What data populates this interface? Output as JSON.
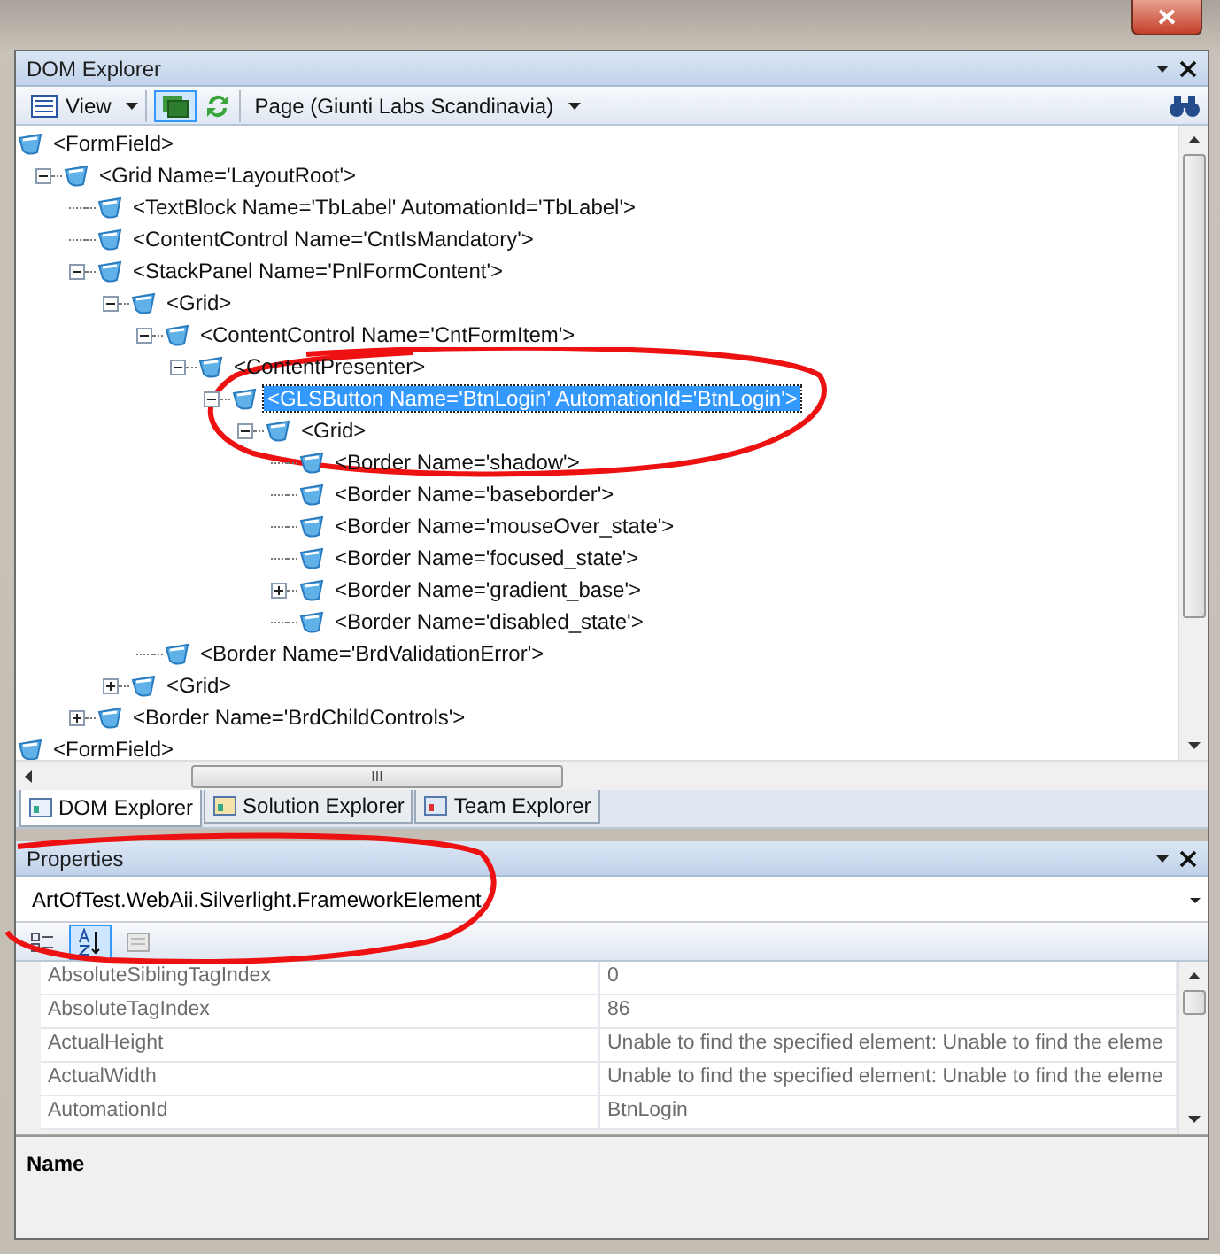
{
  "dom_explorer": {
    "title": "DOM Explorer",
    "toolbar": {
      "view_label": "View",
      "page_label": "Page (Giunti Labs Scandinavia)"
    },
    "tree": [
      {
        "label": "<FormField>",
        "selected": false,
        "children": [
          {
            "label": "<Grid Name='LayoutRoot'>",
            "selected": false,
            "expanded": true,
            "children": [
              {
                "label": "<TextBlock Name='TbLabel' AutomationId='TbLabel'>",
                "selected": false
              },
              {
                "label": "<ContentControl Name='CntIsMandatory'>",
                "selected": false
              },
              {
                "label": "<StackPanel Name='PnlFormContent'>",
                "selected": false,
                "expanded": true,
                "children": [
                  {
                    "label": "<Grid>",
                    "selected": false,
                    "expanded": true,
                    "children": [
                      {
                        "label": "<ContentControl Name='CntFormItem'>",
                        "selected": false,
                        "expanded": true,
                        "children": [
                          {
                            "label": "<ContentPresenter>",
                            "selected": false,
                            "expanded": true,
                            "children": [
                              {
                                "label": "<GLSButton Name='BtnLogin' AutomationId='BtnLogin'>",
                                "selected": true,
                                "expanded": true,
                                "children": [
                                  {
                                    "label": "<Grid>",
                                    "selected": false,
                                    "expanded": true,
                                    "children": [
                                      {
                                        "label": "<Border Name='shadow'>",
                                        "selected": false
                                      },
                                      {
                                        "label": "<Border Name='baseborder'>",
                                        "selected": false
                                      },
                                      {
                                        "label": "<Border Name='mouseOver_state'>",
                                        "selected": false
                                      },
                                      {
                                        "label": "<Border Name='focused_state'>",
                                        "selected": false
                                      },
                                      {
                                        "label": "<Border Name='gradient_base'>",
                                        "selected": false,
                                        "expanded": false
                                      },
                                      {
                                        "label": "<Border Name='disabled_state'>",
                                        "selected": false
                                      }
                                    ]
                                  }
                                ]
                              }
                            ]
                          }
                        ]
                      },
                      {
                        "label": "<Border Name='BrdValidationError'>",
                        "selected": false
                      }
                    ]
                  },
                  {
                    "label": "<Grid>",
                    "selected": false,
                    "expanded": false
                  }
                ]
              },
              {
                "label": "<Border Name='BrdChildControls'>",
                "selected": false,
                "expanded": false
              }
            ]
          }
        ]
      },
      {
        "label": "<FormField>",
        "selected": false
      }
    ],
    "scroll_grip": "III",
    "tabs": [
      {
        "label": "DOM Explorer",
        "selected": true
      },
      {
        "label": "Solution Explorer",
        "selected": false
      },
      {
        "label": "Team Explorer",
        "selected": false
      }
    ]
  },
  "properties": {
    "title": "Properties",
    "object": "ArtOfTest.WebAii.Silverlight.FrameworkElement",
    "sort_buttons": [
      {
        "kind": "categorized",
        "selected": false
      },
      {
        "kind": "alphabetical",
        "selected": true
      },
      {
        "kind": "pages",
        "selected": false
      }
    ],
    "rows": [
      {
        "name": "AbsoluteSiblingTagIndex",
        "value": "0"
      },
      {
        "name": "AbsoluteTagIndex",
        "value": "86"
      },
      {
        "name": "ActualHeight",
        "value": "Unable to find the specified element: Unable to find the eleme"
      },
      {
        "name": "ActualWidth",
        "value": "Unable to find the specified element: Unable to find the eleme"
      },
      {
        "name": "AutomationId",
        "value": "BtnLogin"
      }
    ],
    "description_title": "Name"
  }
}
